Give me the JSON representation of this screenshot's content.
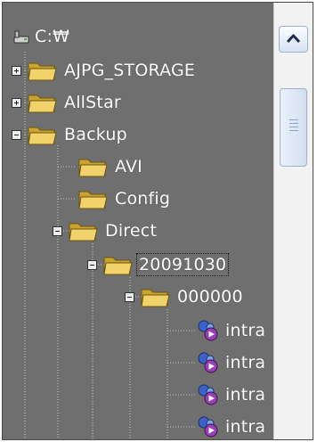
{
  "tree": {
    "root_label": "C:₩",
    "items": [
      {
        "label": "AJPG_STORAGE",
        "state": "collapsed",
        "icon": "folder-icon"
      },
      {
        "label": "AllStar",
        "state": "collapsed",
        "icon": "folder-icon"
      },
      {
        "label": "Backup",
        "state": "expanded",
        "icon": "folder-icon"
      },
      {
        "label": "AVI",
        "icon": "folder-icon"
      },
      {
        "label": "Config",
        "icon": "folder-icon"
      },
      {
        "label": "Direct",
        "state": "expanded",
        "icon": "folder-icon"
      },
      {
        "label": "20091030",
        "state": "expanded",
        "icon": "folder-icon",
        "focused": true
      },
      {
        "label": "000000",
        "state": "expanded",
        "icon": "folder-icon"
      },
      {
        "label": "intra",
        "icon": "video-file-icon"
      },
      {
        "label": "intra",
        "icon": "video-file-icon"
      },
      {
        "label": "intra",
        "icon": "video-file-icon"
      },
      {
        "label": "intra",
        "icon": "video-file-icon"
      }
    ]
  },
  "scrollbar": {
    "up_icon": "chevron-up-icon",
    "thumb_icon": "grip-icon"
  },
  "colors": {
    "tree_background": "#6f6f6f",
    "text": "#ffffff",
    "folder": "#e9c44a",
    "scrollbar_background": "#f2f2f2",
    "scroll_button": "#d7e3f3"
  }
}
